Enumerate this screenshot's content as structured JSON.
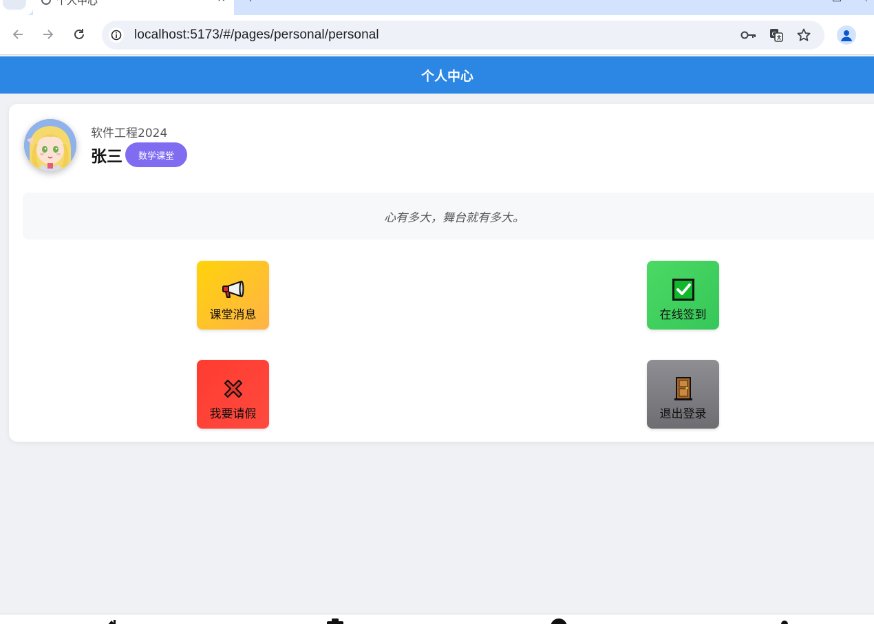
{
  "browser": {
    "tab_title": "个人中心",
    "tab_close": "×",
    "new_tab": "+",
    "url": "localhost:5173/#/pages/personal/personal"
  },
  "header": {
    "title": "个人中心"
  },
  "profile": {
    "class_name": "软件工程2024",
    "user_name": "张三",
    "badge": "数学课堂"
  },
  "motto": "心有多大，舞台就有多大。",
  "actions": [
    {
      "label": "课堂消息",
      "icon": "megaphone-icon",
      "color_start": "#ffd30a",
      "color_end": "#ffb347"
    },
    {
      "label": "在线签到",
      "icon": "check-box-icon",
      "color_start": "#4cd964",
      "color_end": "#35c759"
    },
    {
      "label": "我要请假",
      "icon": "cross-mark-icon",
      "color_start": "#ff3b30",
      "color_end": "#ff4a3f"
    },
    {
      "label": "退出登录",
      "icon": "door-icon",
      "color_start": "#8e8e93",
      "color_end": "#6d6d72"
    }
  ],
  "colors": {
    "header_bg": "#2b87e3",
    "badge_bg": "#7f6cf0",
    "page_bg": "#f0f1f5"
  }
}
